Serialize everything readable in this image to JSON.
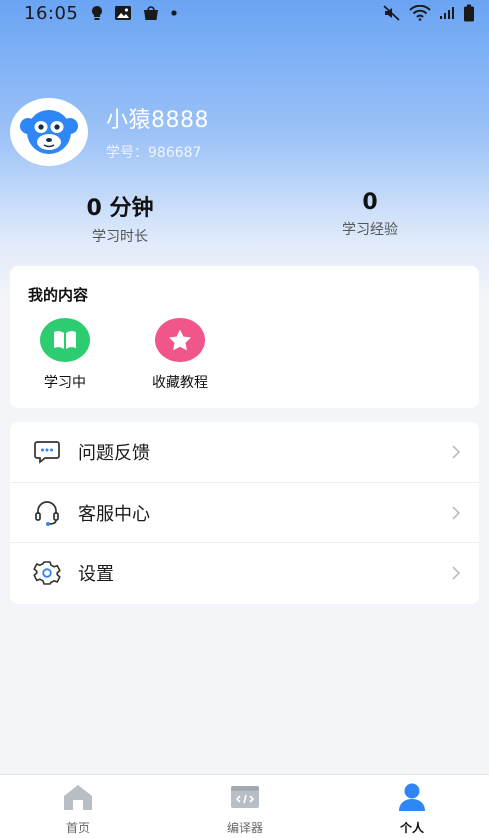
{
  "status_bar": {
    "time": "16:05",
    "left_icons": [
      "bulb-icon",
      "image-icon",
      "bag-icon",
      "dot-icon"
    ],
    "right_icons": [
      "mute-icon",
      "wifi-icon",
      "signal-icon",
      "battery-icon"
    ]
  },
  "profile": {
    "username": "小猿8888",
    "student_id": "学号：986687",
    "avatar_icon": "monkey-avatar-icon"
  },
  "stats": {
    "study_time_value": "0 分钟",
    "study_time_label": "学习时长",
    "experience_value": "0",
    "experience_label": "学习经验"
  },
  "my_content": {
    "title": "我的内容",
    "items": [
      {
        "label": "学习中",
        "icon": "book-icon",
        "color": "#2ecc71"
      },
      {
        "label": "收藏教程",
        "icon": "star-icon",
        "color": "#f0568a"
      }
    ]
  },
  "menu": {
    "items": [
      {
        "label": "问题反馈",
        "icon": "chat-bubble-icon"
      },
      {
        "label": "客服中心",
        "icon": "headset-icon"
      },
      {
        "label": "设置",
        "icon": "gear-icon"
      }
    ]
  },
  "tabbar": {
    "tabs": [
      {
        "label": "首页",
        "icon": "home-icon",
        "active": false
      },
      {
        "label": "编译器",
        "icon": "code-window-icon",
        "active": false
      },
      {
        "label": "个人",
        "icon": "person-icon",
        "active": true
      }
    ],
    "active_color": "#2f86f5"
  }
}
